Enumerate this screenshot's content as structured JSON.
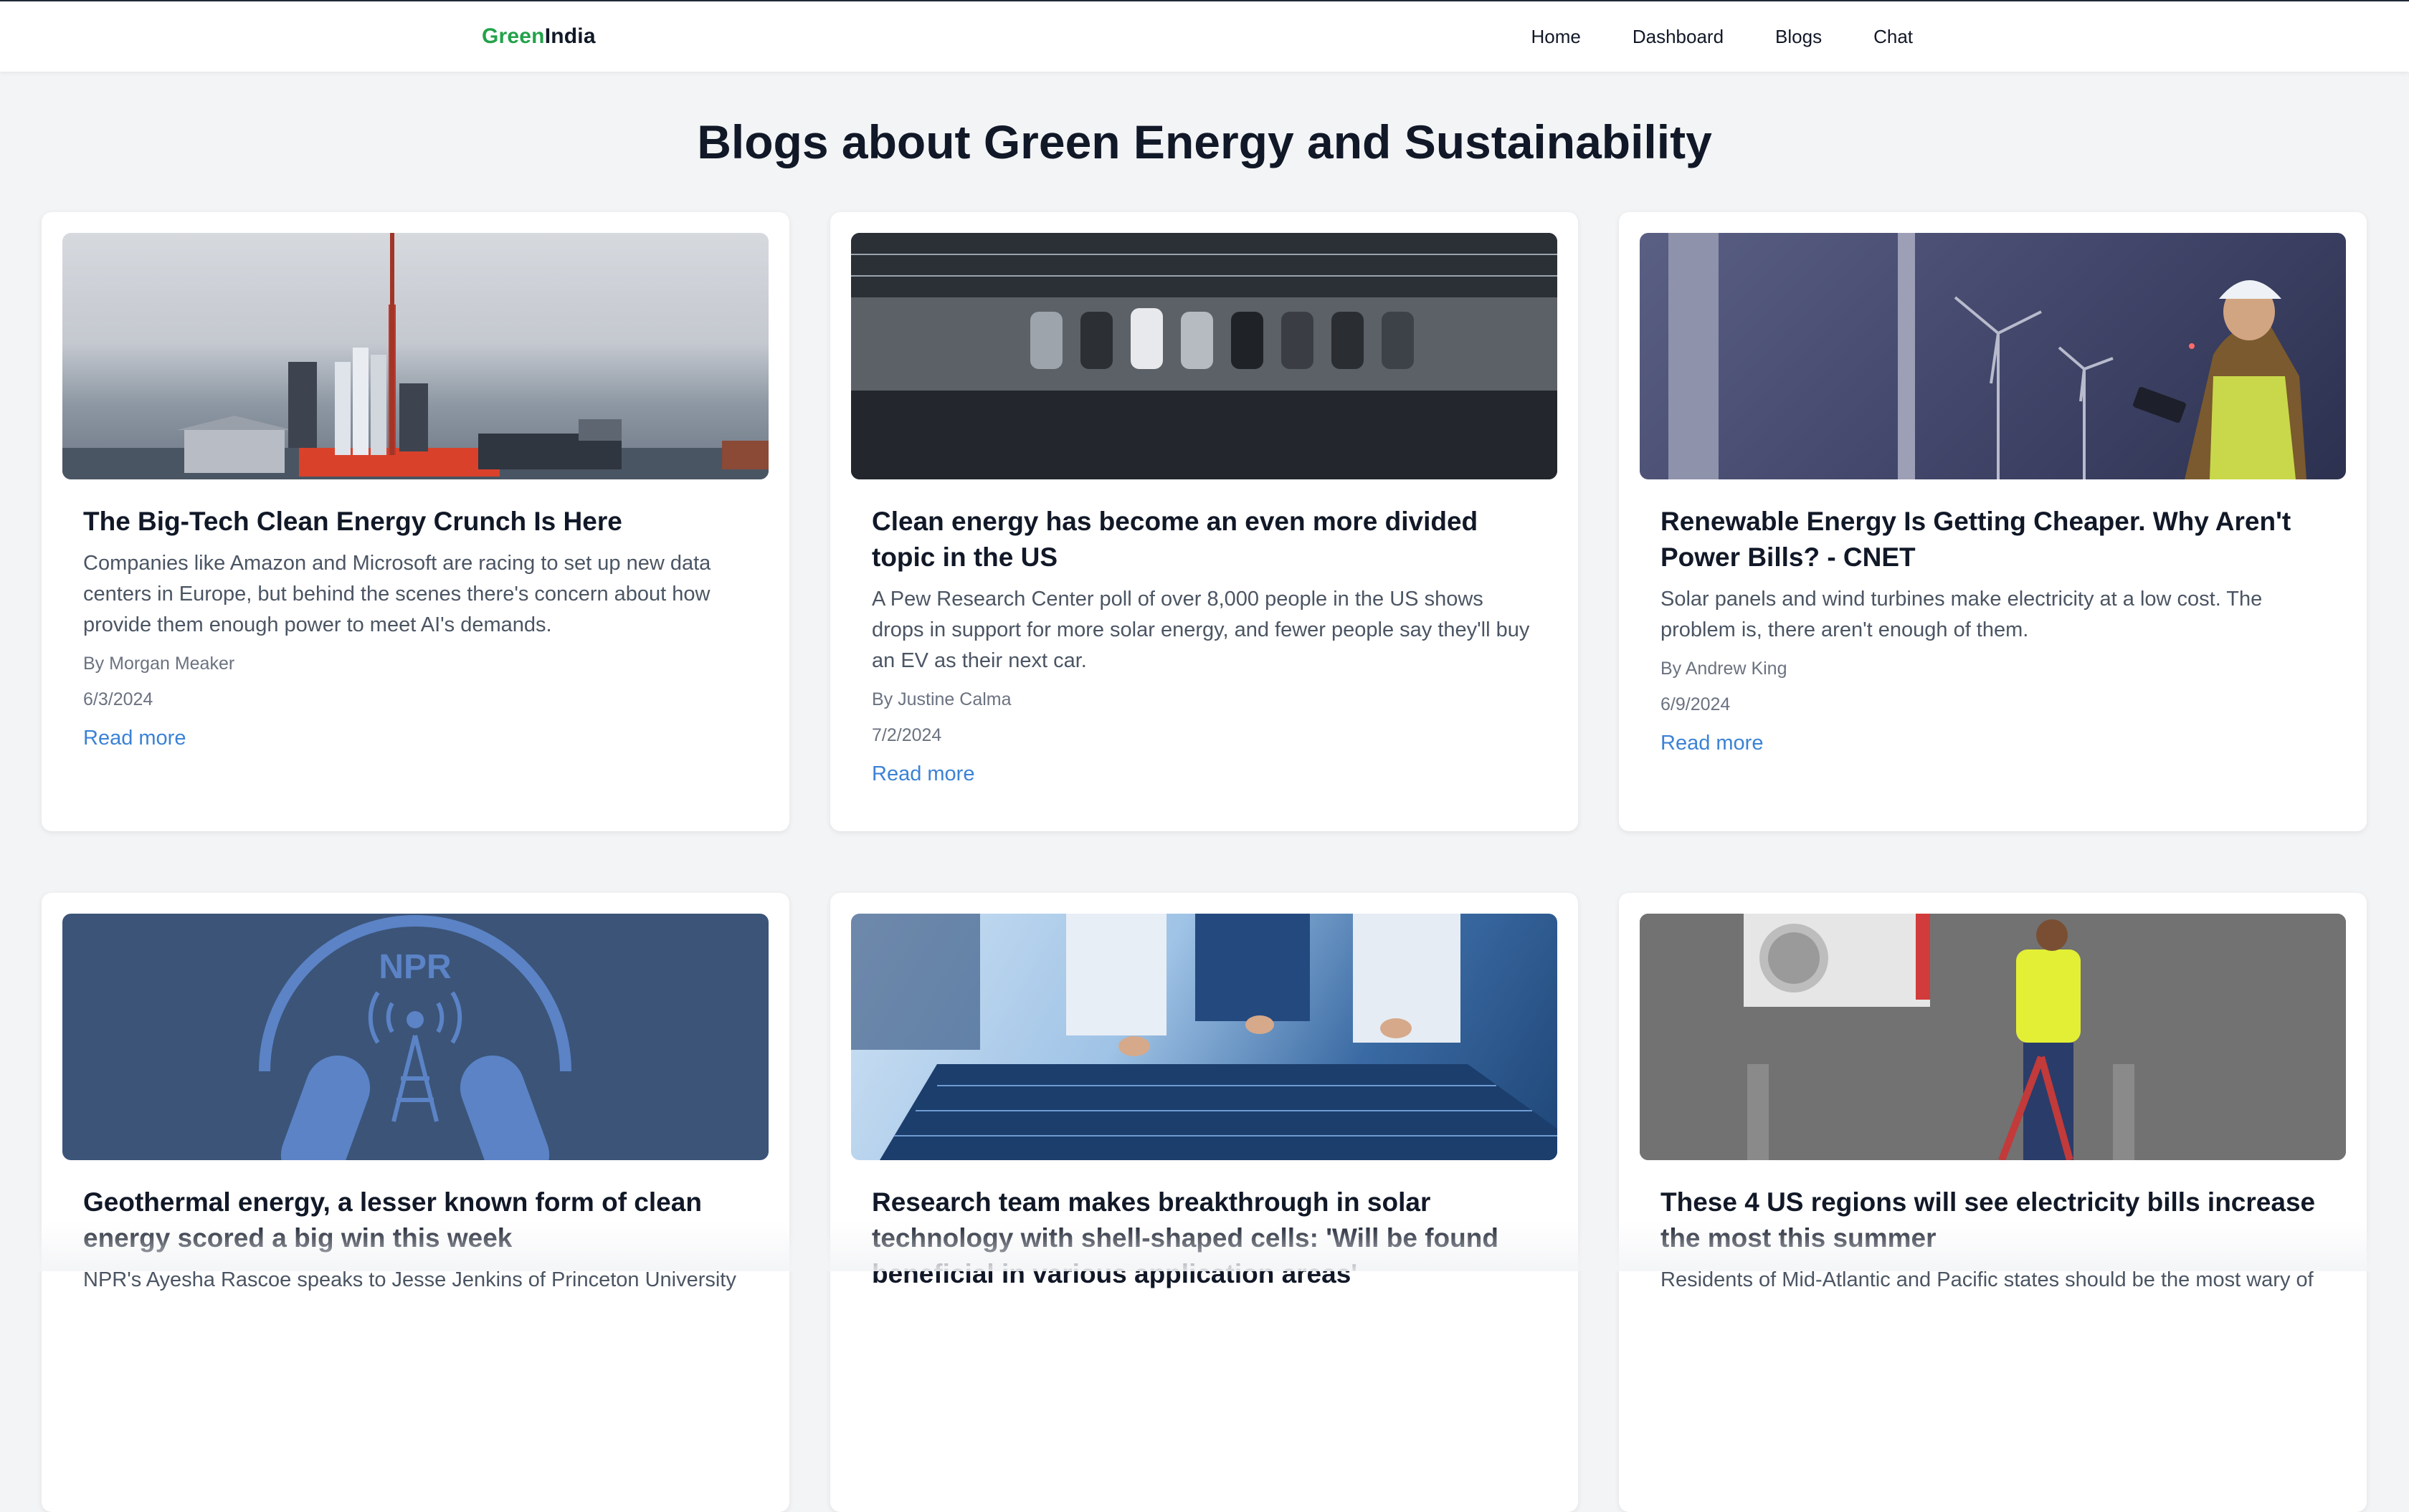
{
  "nav": {
    "brand_green": "Green",
    "brand_dark": "India",
    "links": [
      "Home",
      "Dashboard",
      "Blogs",
      "Chat"
    ]
  },
  "page": {
    "title": "Blogs about Green Energy and Sustainability"
  },
  "posts": [
    {
      "title": "The Big-Tech Clean Energy Crunch Is Here",
      "description": "Companies like Amazon and Microsoft are racing to set up new data centers in Europe, but behind the scenes there's concern about how provide them enough power to meet AI's demands.",
      "author": "By Morgan Meaker",
      "date": "6/3/2024",
      "link": "Read more"
    },
    {
      "title": "Clean energy has become an even more divided topic in the US",
      "description": "A Pew Research Center poll of over 8,000 people in the US shows drops in support for more solar energy, and fewer people say they'll buy an EV as their next car.",
      "author": "By Justine Calma",
      "date": "7/2/2024",
      "link": "Read more"
    },
    {
      "title": "Renewable Energy Is Getting Cheaper. Why Aren't Power Bills? - CNET",
      "description": "Solar panels and wind turbines make electricity at a low cost. The problem is, there aren't enough of them.",
      "author": "By Andrew King",
      "date": "6/9/2024",
      "link": "Read more"
    },
    {
      "title": "Geothermal energy, a lesser known form of clean energy scored a big win this week",
      "description": "NPR's Ayesha Rascoe speaks to Jesse Jenkins of Princeton University",
      "image_text": "NPR"
    },
    {
      "title": "Research team makes breakthrough in solar technology with shell-shaped cells: 'Will be found beneficial in various application areas'",
      "description": ""
    },
    {
      "title": "These 4 US regions will see electricity bills increase the most this summer",
      "description": "Residents of Mid-Atlantic and Pacific states should be the most wary of"
    }
  ],
  "colors": {
    "brand_green": "#22a24a",
    "link_blue": "#3b82d6",
    "background": "#f3f4f6"
  }
}
